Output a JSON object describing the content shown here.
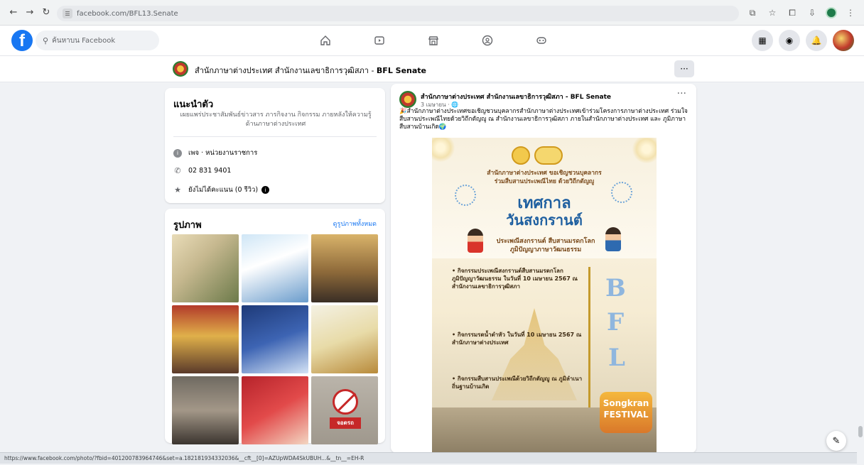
{
  "browser": {
    "url": "facebook.com/BFL13.Senate",
    "status_url": "https://www.facebook.com/photo/?fbid=401200783964746&set=a.182181934332036&__cft__[0]=AZUpWDA4SkUBUH...&__tn__=EH-R"
  },
  "facebook": {
    "logo_letter": "f",
    "search_placeholder": "ค้นหาบน Facebook"
  },
  "page": {
    "name": "สำนักภาษาต่างประเทศ สำนักงานเลขาธิการวุฒิสภา - ",
    "name_bold": "BFL Senate",
    "more_label": "···"
  },
  "intro": {
    "title": "แนะนำตัว",
    "description": "เผยแพร่ประชาสัมพันธ์ข่าวสาร ภารกิจงาน กิจกรรม ภายหลังให้ความรู้ด้านภาษาต่างประเทศ",
    "category": "เพจ · หน่วยงานราชการ",
    "phone": "02 831 9401",
    "rating": "ยังไม่ได้คะแนน (0 รีวิว)"
  },
  "photos": {
    "title": "รูปภาพ",
    "see_all": "ดูรูปภาพทั้งหมด",
    "sign_text": "จอดรถ"
  },
  "post": {
    "author": "สำนักภาษาต่างประเทศ สำนักงานเลขาธิการวุฒิสภา - BFL Senate",
    "date": "3 เมษายน · 🌐",
    "more": "···",
    "text": "🎉สำนักภาษาต่างประเทศขอเชิญชวนบุคลากรสำนักภาษาต่างประเทศเข้าร่วมโครงการภาษาต่างประเทศ ร่วมใจสืบสานประเพณีไทยด้วยวิถีกตัญญู ณ สำนักงานเลขาธิการวุฒิสภา ภายในสำนักภาษาต่างประเทศ และ ภูมิภาษาสืบสานบ้านเกิด🌍",
    "poster": {
      "sub1": "สำนักภาษาต่างประเทศ ขอเชิญชวนบุคลากร",
      "sub2": "ร่วมสืบสานประเพณีไทย ด้วยวิถีกตัญญู",
      "title1": "เทศกาล",
      "title2": "วันสงกรานต์",
      "mid1": "ประเพณีสงกรานต์ สืบสานมรดกโลก",
      "mid2": "ภูมิปัญญาภาษาวัฒนธรรม",
      "bullet1": "• กิจกรรมประเพณีสงกรานต์สืบสานมรดกโลก ภูมิปัญญาวัฒนธรรม ในวันที่ 10 เมษายน 2567 ณ สำนักงานเลขาธิการวุฒิสภา",
      "bullet2": "• กิจกรรมรดน้ำดำหัว ในวันที่ 10 เมษายน 2567 ณ สำนักภาษาต่างประเทศ",
      "bullet3": "• กิจกรรมสืบสานประเพณีด้วยวิถีกตัญญู ณ ภูมิลำเนาถิ่นฐานบ้านเกิด",
      "festival1": "Songkran",
      "festival2": "FESTIVAL",
      "b": "B",
      "f": "F",
      "l": "L"
    }
  }
}
